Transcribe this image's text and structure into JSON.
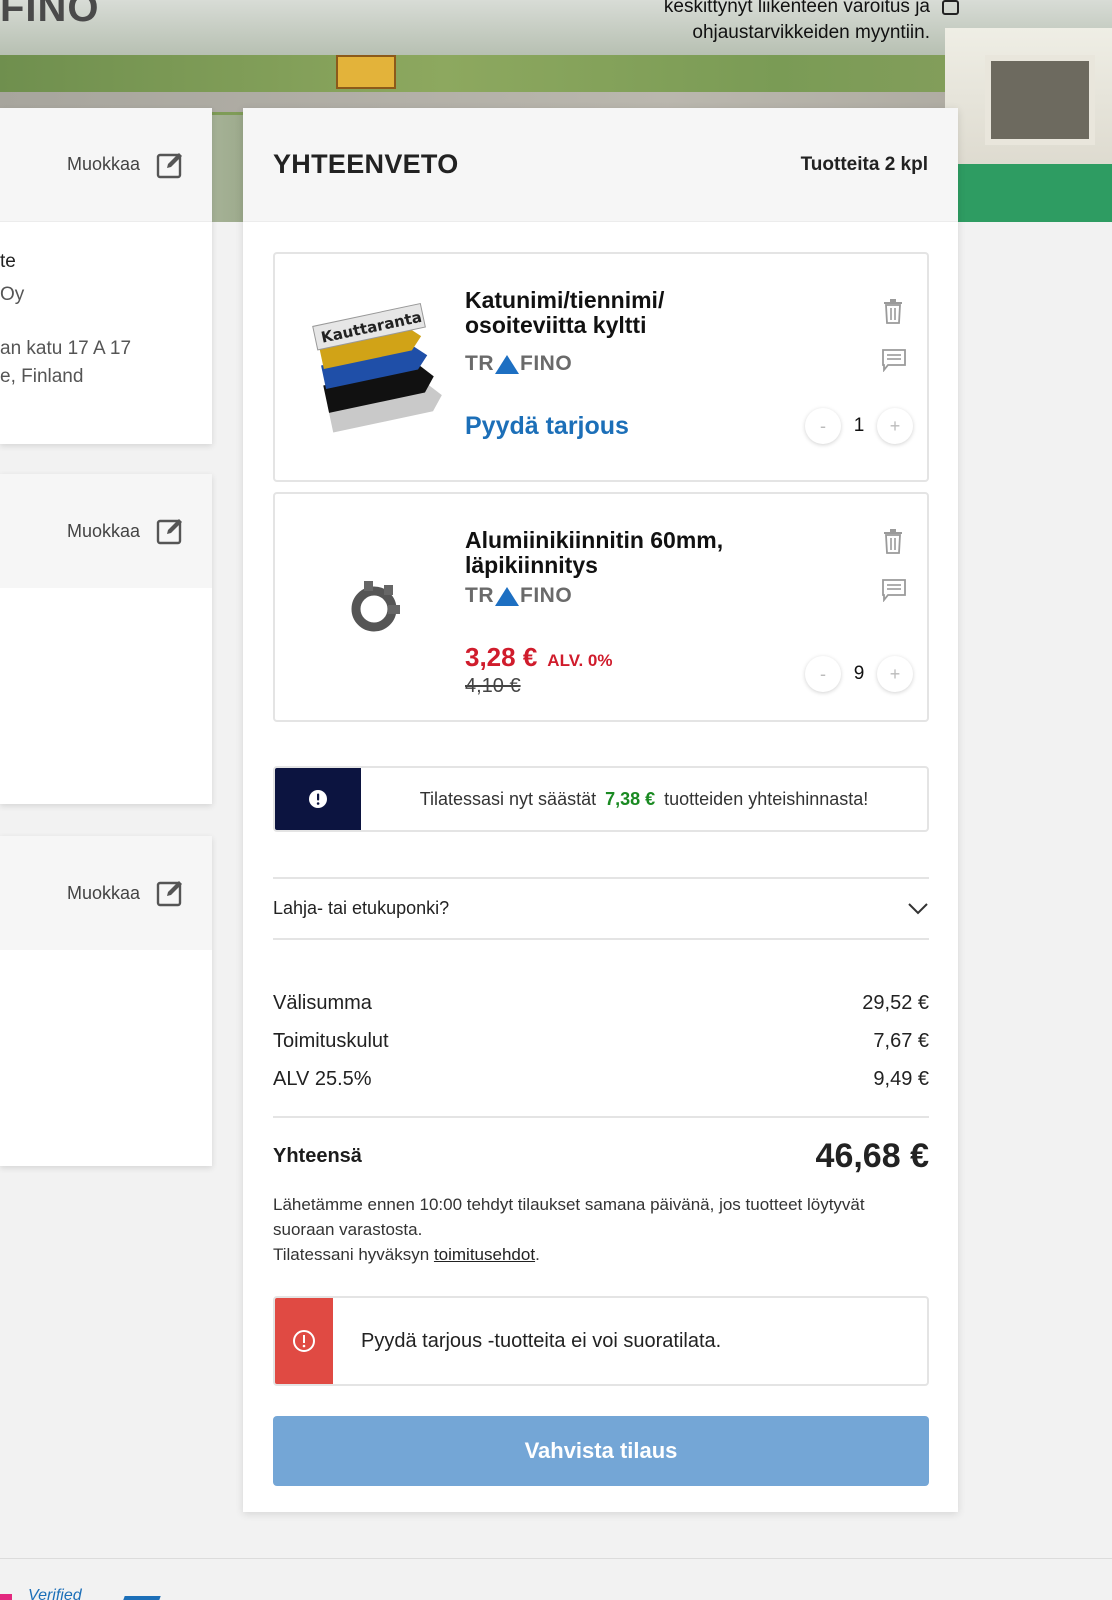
{
  "hero": {
    "logo_fragment": "FINO",
    "tagline_line1": "keskittynyt liikenteen varoitus ja",
    "tagline_line2": "ohjaustarvikkeiden myyntiin."
  },
  "left_cards": {
    "edit_label": "Muokkaa",
    "address": {
      "name_fragment": "te",
      "company_fragment": "Oy",
      "street_fragment": "an katu 17 A 17",
      "city_fragment": "e, Finland"
    }
  },
  "summary": {
    "title": "YHTEENVETO",
    "count": "Tuotteita 2 kpl",
    "items": [
      {
        "name_line1": "Katunimi/tiennimi/",
        "name_line2": "osoiteviitta kyltti",
        "brand_left": "TR",
        "brand_right": "FINO",
        "thumb_sign_text": "Kauttaranta",
        "action": "Pyydä tarjous",
        "minus": "-",
        "plus": "+",
        "quantity": "1"
      },
      {
        "name_line1": "Alumiinikiinnitin 60mm,",
        "name_line2": "läpikiinnitys",
        "brand_left": "TR",
        "brand_right": "FINO",
        "price": "3,28 €",
        "vat": "ALV. 0%",
        "old_price": "4,10 €",
        "minus": "-",
        "plus": "+",
        "quantity": "9"
      }
    ],
    "savings": {
      "prefix": "Tilatessasi nyt säästät",
      "amount": "7,38 €",
      "suffix": "tuotteiden yhteishinnasta!"
    },
    "coupon_label": "Lahja- tai etukuponki?",
    "totals": [
      {
        "label": "Välisumma",
        "value": "29,52 €"
      },
      {
        "label": "Toimituskulut",
        "value": "7,67 €"
      },
      {
        "label": "ALV 25.5%",
        "value": "9,49 €"
      }
    ],
    "grand_total": {
      "label": "Yhteensä",
      "value": "46,68 €"
    },
    "info_line1": "Lähetämme ennen 10:00 tehdyt tilaukset samana päivänä, jos tuotteet löytyvät suoraan varastosta.",
    "info_line2_prefix": "Tilatessani hyväksyn ",
    "info_link": "toimitusehdot",
    "info_line2_suffix": ".",
    "warning": "Pyydä tarjous -tuotteita ei voi suoratilata.",
    "confirm_button": "Vahvista tilaus"
  },
  "footer": {
    "fragment": "Verified"
  },
  "colors": {
    "accent_blue": "#1c6fb8",
    "price_red": "#d01c2c",
    "savings_green": "#1a8a22",
    "savings_side": "#0c1440",
    "warning_red": "#e04a43",
    "confirm_button": "#74a6d6"
  },
  "icons": {
    "edit": "edit-icon",
    "trash": "trash-icon",
    "comment": "comment-icon",
    "chevron": "chevron-down-icon",
    "info": "exclamation-icon",
    "warning": "warning-icon"
  }
}
